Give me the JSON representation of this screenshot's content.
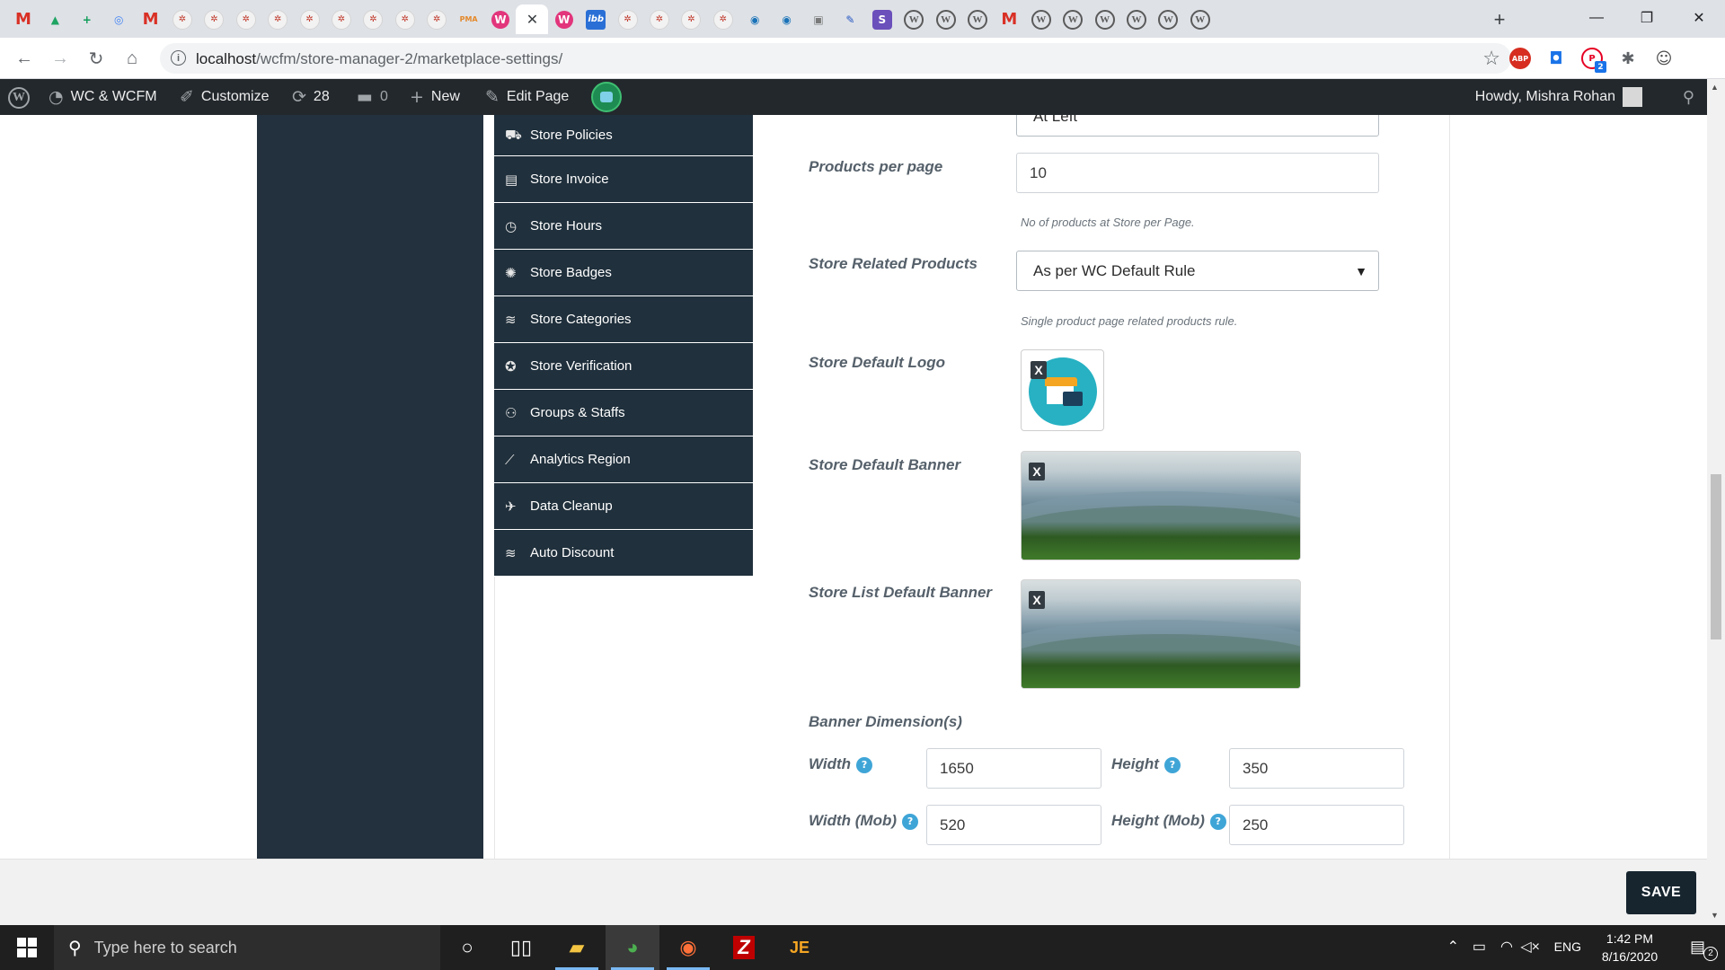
{
  "browser": {
    "tabs": [
      {
        "icon": "gmail-icon",
        "glyph": "M",
        "kind": "gmail"
      },
      {
        "icon": "google-drive-icon",
        "glyph": "▲",
        "color": "#1fa463"
      },
      {
        "icon": "google-sheets-icon",
        "glyph": "+",
        "color": "#0f9d58"
      },
      {
        "icon": "inbox-icon",
        "glyph": "◎",
        "color": "#4285f4"
      },
      {
        "icon": "gmail-icon",
        "glyph": "M",
        "kind": "gmail"
      },
      {
        "icon": "wcfm-icon",
        "glyph": "✲",
        "kind": "wc"
      },
      {
        "icon": "wcfm-icon",
        "glyph": "✲",
        "kind": "wc"
      },
      {
        "icon": "wcfm-icon",
        "glyph": "✲",
        "kind": "wc"
      },
      {
        "icon": "wcfm-icon",
        "glyph": "✲",
        "kind": "wc"
      },
      {
        "icon": "wcfm-icon",
        "glyph": "✲",
        "kind": "wc"
      },
      {
        "icon": "wcfm-icon",
        "glyph": "✲",
        "kind": "wc"
      },
      {
        "icon": "wcfm-icon",
        "glyph": "✲",
        "kind": "wc"
      },
      {
        "icon": "wcfm-icon",
        "glyph": "✲",
        "kind": "wc"
      },
      {
        "icon": "wcfm-icon",
        "glyph": "✲",
        "kind": "wc"
      },
      {
        "icon": "phpmyadmin-icon",
        "glyph": "PMA",
        "color": "#e4892b"
      },
      {
        "icon": "wcfm-marketplace-icon",
        "glyph": "W",
        "color": "#e2357b"
      },
      {
        "icon": "close-tab-icon",
        "glyph": "✕",
        "active": true
      },
      {
        "icon": "wcfm-marketplace-icon",
        "glyph": "W",
        "color": "#e2357b"
      },
      {
        "icon": "imgbb-icon",
        "glyph": "ibb",
        "color": "#2a6fd6"
      },
      {
        "icon": "wcfm-icon",
        "glyph": "✲",
        "kind": "wc"
      },
      {
        "icon": "wcfm-icon",
        "glyph": "✲",
        "kind": "wc"
      },
      {
        "icon": "wcfm-icon",
        "glyph": "✲",
        "kind": "wc"
      },
      {
        "icon": "wcfm-icon",
        "glyph": "✲",
        "kind": "wc"
      },
      {
        "icon": "globe-icon",
        "glyph": "◉",
        "color": "#1a73b8"
      },
      {
        "icon": "globe-icon",
        "glyph": "◉",
        "color": "#1a73b8"
      },
      {
        "icon": "screen-icon",
        "glyph": "▣",
        "color": "#7a7a7a"
      },
      {
        "icon": "feather-icon",
        "glyph": "✎",
        "color": "#2457c5"
      },
      {
        "icon": "s-app-icon",
        "glyph": "S",
        "color": "#6b4fbb"
      },
      {
        "icon": "wordpress-icon",
        "glyph": "W",
        "kind": "wp"
      },
      {
        "icon": "wordpress-icon",
        "glyph": "W",
        "kind": "wp"
      },
      {
        "icon": "wordpress-icon",
        "glyph": "W",
        "kind": "wp"
      },
      {
        "icon": "gmail-icon",
        "glyph": "M",
        "kind": "gmail"
      },
      {
        "icon": "wordpress-icon",
        "glyph": "W",
        "kind": "wp"
      },
      {
        "icon": "wordpress-icon",
        "glyph": "W",
        "kind": "wp"
      },
      {
        "icon": "wordpress-icon",
        "glyph": "W",
        "kind": "wp"
      },
      {
        "icon": "wordpress-icon",
        "glyph": "W",
        "kind": "wp"
      },
      {
        "icon": "wordpress-icon",
        "glyph": "W",
        "kind": "wp"
      },
      {
        "icon": "wordpress-icon",
        "glyph": "W",
        "kind": "wp"
      }
    ],
    "url_host": "localhost",
    "url_path": "/wcfm/store-manager-2/marketplace-settings/",
    "extensions": [
      {
        "icon": "adblock-plus-icon",
        "glyph": "ABP",
        "color": "#d62d20"
      },
      {
        "icon": "screenshot-icon",
        "glyph": "◘",
        "color": "#1a73e8"
      },
      {
        "icon": "pinterest-icon",
        "glyph": "P",
        "color": "#e60023",
        "badge": "2"
      },
      {
        "icon": "extensions-puzzle-icon",
        "glyph": "✱",
        "color": "#5f6368"
      },
      {
        "icon": "profile-avatar-icon",
        "glyph": "☺",
        "color": "#4a4a4a"
      }
    ]
  },
  "adminbar": {
    "site_name": "WC & WCFM",
    "customize": "Customize",
    "updates": "28",
    "comments": "0",
    "new": "New",
    "edit_page": "Edit Page",
    "howdy": "Howdy, Mishra Rohan"
  },
  "settings_menu": [
    {
      "icon": "store-policies-icon",
      "glyph": "⛟",
      "label": "Store Policies"
    },
    {
      "icon": "store-invoice-icon",
      "glyph": "▤",
      "label": "Store Invoice"
    },
    {
      "icon": "store-hours-icon",
      "glyph": "◷",
      "label": "Store Hours"
    },
    {
      "icon": "store-badges-icon",
      "glyph": "✺",
      "label": "Store Badges"
    },
    {
      "icon": "store-categories-icon",
      "glyph": "≋",
      "label": "Store Categories"
    },
    {
      "icon": "store-verification-icon",
      "glyph": "✪",
      "label": "Store Verification"
    },
    {
      "icon": "groups-staffs-icon",
      "glyph": "⚇",
      "label": "Groups & Staffs"
    },
    {
      "icon": "analytics-region-icon",
      "glyph": "⟋",
      "label": "Analytics Region"
    },
    {
      "icon": "data-cleanup-icon",
      "glyph": "✈",
      "label": "Data Cleanup"
    },
    {
      "icon": "auto-discount-icon",
      "glyph": "≋",
      "label": "Auto Discount"
    }
  ],
  "form": {
    "top_select_value": "At Left",
    "products_per_page": {
      "label": "Products per page",
      "value": "10",
      "help": "No of products at Store per Page."
    },
    "related_products": {
      "label": "Store Related Products",
      "value": "As per WC Default Rule",
      "help": "Single product page related products rule."
    },
    "default_logo": {
      "label": "Store Default Logo"
    },
    "default_banner": {
      "label": "Store Default Banner"
    },
    "list_banner": {
      "label": "Store List Default Banner"
    },
    "remove_label": "X",
    "banner_dimensions": {
      "title": "Banner Dimension(s)",
      "width_label": "Width",
      "width_value": "1650",
      "height_label": "Height",
      "height_value": "350",
      "width_mob_label": "Width (Mob)",
      "width_mob_value": "520",
      "height_mob_label": "Height (Mob)",
      "height_mob_value": "250"
    }
  },
  "save_label": "SAVE",
  "taskbar": {
    "search_placeholder": "Type here to search",
    "apps": [
      {
        "icon": "cortana-icon",
        "glyph": "○"
      },
      {
        "icon": "task-view-icon",
        "glyph": "▯▯"
      },
      {
        "icon": "file-explorer-icon",
        "glyph": "▰",
        "color": "#f4c542",
        "running": true
      },
      {
        "icon": "chrome-icon",
        "glyph": "◕",
        "color": "#4caf50",
        "running": true,
        "active": true
      },
      {
        "icon": "firefox-icon",
        "glyph": "◉",
        "color": "#ff7139",
        "running": true
      },
      {
        "icon": "filezilla-icon",
        "glyph": "Z",
        "color": "#ffffff",
        "bg": "#bf0000"
      },
      {
        "icon": "jetbrains-icon",
        "glyph": "JE",
        "color": "#f5a623"
      }
    ],
    "tray_language": "ENG",
    "time": "1:42 PM",
    "date": "8/16/2020",
    "notification_count": "2"
  }
}
